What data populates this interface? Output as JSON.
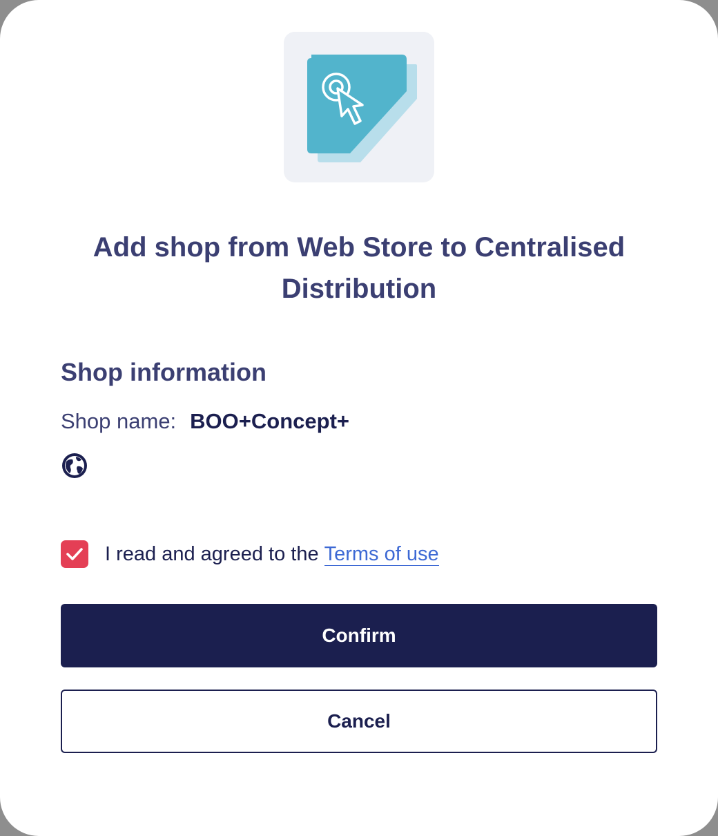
{
  "dialog": {
    "logo_icon": "click-cursor-app-icon",
    "title": "Add shop from Web Store to Centralised Distribution",
    "section_title": "Shop information",
    "shop": {
      "label": "Shop name:",
      "value": "BOO+Concept+",
      "website_icon": "globe-icon"
    },
    "agreement": {
      "checked": true,
      "text": "I read and agreed to the",
      "link_text": "Terms of use"
    },
    "buttons": {
      "confirm_label": "Confirm",
      "cancel_label": "Cancel"
    },
    "colors": {
      "heading": "#3b3f72",
      "primary": "#1b1f4f",
      "checkbox": "#e43f55",
      "link": "#3d69d4",
      "logo_teal": "#52b4cc",
      "logo_shadow": "#b8deeb"
    }
  }
}
